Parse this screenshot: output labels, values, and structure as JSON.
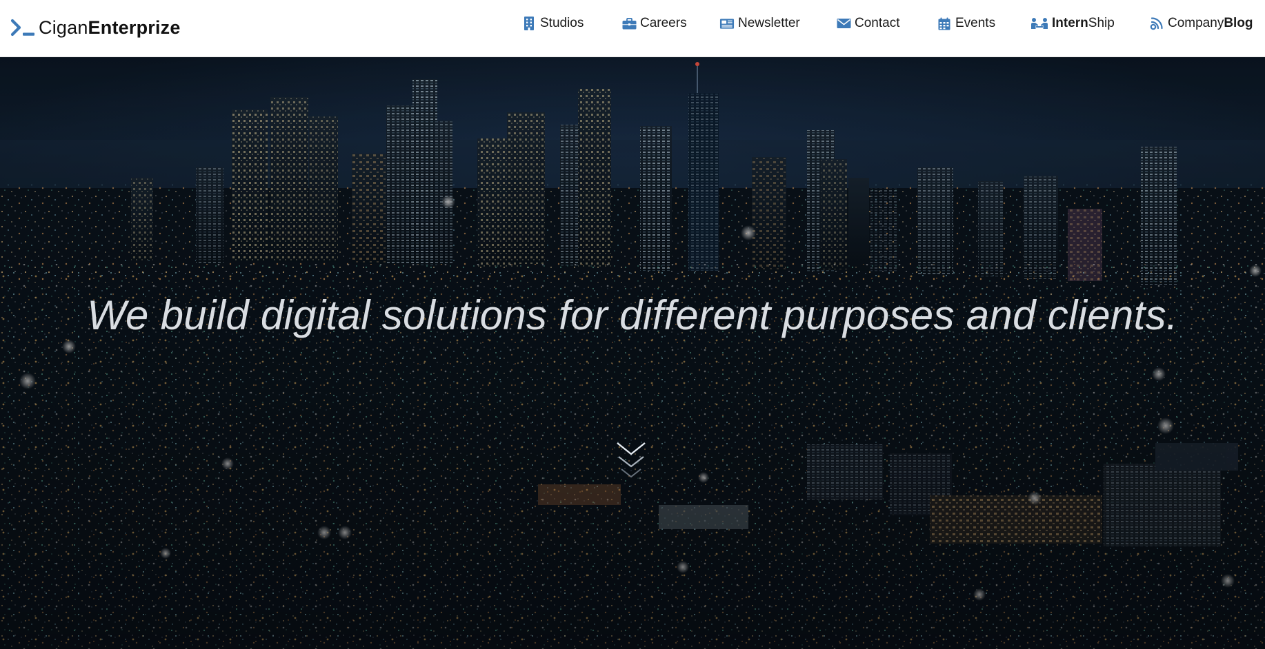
{
  "brand": {
    "light": "Cigan",
    "bold": "Enterprize",
    "icon": "terminal-prompt-icon",
    "accent": "#3d7ab8"
  },
  "nav": {
    "items": [
      {
        "label": "Studios",
        "icon": "building-icon"
      },
      {
        "label": "Careers",
        "icon": "briefcase-icon"
      },
      {
        "label": "Newsletter",
        "icon": "newspaper-icon"
      },
      {
        "label": "Contact",
        "icon": "envelope-icon"
      },
      {
        "label": "Events",
        "icon": "calendar-icon"
      },
      {
        "label_strong": "Intern",
        "label_rest": "Ship",
        "icon": "people-meeting-icon"
      },
      {
        "label_rest": "Company",
        "label_strong": "Blog",
        "icon": "rss-blog-icon"
      }
    ],
    "icon_color": "#3d7ab8"
  },
  "hero": {
    "headline": "We build digital solutions for different purposes and clients.",
    "scroll_icon": "chevrons-down-icon",
    "background": "night-city-skyline"
  }
}
